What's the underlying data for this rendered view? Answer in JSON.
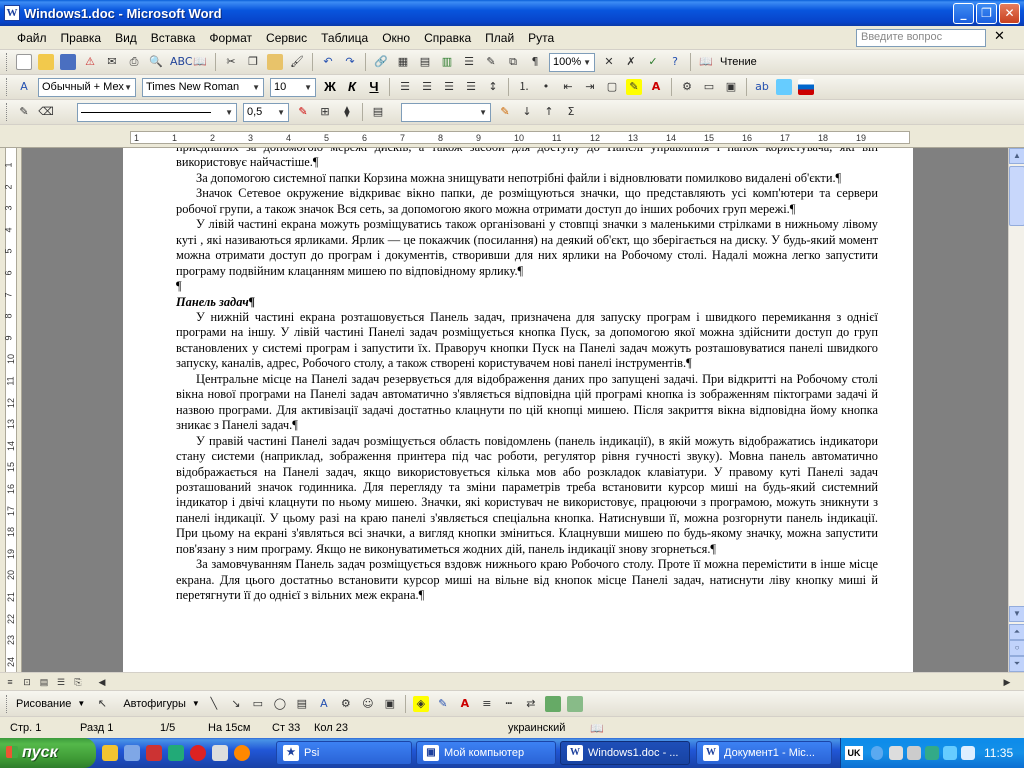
{
  "window": {
    "title": "Windows1.doc - Microsoft Word",
    "app_icon": "W",
    "minimize": "_",
    "maximize": "❐",
    "close": "✕"
  },
  "menubar": {
    "items": [
      "Файл",
      "Правка",
      "Вид",
      "Вставка",
      "Формат",
      "Сервис",
      "Таблица",
      "Окно",
      "Справка",
      "Плай",
      "Рута"
    ],
    "ask_placeholder": "Введите вопрос",
    "close_doc": "✕"
  },
  "toolbar_standard": {
    "zoom": "100%",
    "reading": "Чтение"
  },
  "toolbar_formatting": {
    "style": "Обычный + Мех",
    "font": "Times New Roman",
    "size": "10",
    "bold": "Ж",
    "italic": "К",
    "underline": "Ч"
  },
  "toolbar_tables": {
    "line_width": "0,5"
  },
  "ruler": {
    "h_numbers": [
      "1",
      "1",
      "2",
      "3",
      "4",
      "5",
      "6",
      "7",
      "8",
      "9",
      "10",
      "11",
      "12",
      "13",
      "14",
      "15",
      "16",
      "17",
      "18",
      "19"
    ],
    "v_numbers": [
      "1",
      "2",
      "3",
      "4",
      "5",
      "6",
      "7",
      "8",
      "9",
      "10",
      "11",
      "12",
      "13",
      "14",
      "15",
      "16",
      "17",
      "18",
      "19",
      "20",
      "21",
      "22",
      "23",
      "24"
    ]
  },
  "document": {
    "paragraphs": [
      {
        "cls": "",
        "text": "приєднаних за допомогою мережі дисків, а також засоби для доступу до Панелі управління і папок користувача, які він використовує найчастіше.¶"
      },
      {
        "cls": "ind",
        "text": "За допомогою системної папки Корзина можна знищувати непотрібні файли і відновлювати помилково видалені об'єкти.¶"
      },
      {
        "cls": "ind",
        "text": "Значок Сетевое окружение відкриває вікно папки, де розміщуються значки, що представляють усі комп'ютери та сервери робочої групи, а також значок Вся сеть, за допомогою якого можна отримати доступ до інших робочих груп мережі.¶"
      },
      {
        "cls": "ind",
        "text": "У лівій частині екрана можуть розміщуватись також організовані у стовпці значки з маленькими стрілками в нижньому лівому куті , які називаються ярликами. Ярлик — це покажчик (посилання) на деякий об'єкт, що зберігається на диску. У будь-який момент можна отримати доступ до програм і документів, створивши для них ярлики на Робочому столі. Надалі можна легко запустити програму подвійним клацанням мишею по відповідному ярлику.¶"
      },
      {
        "cls": "",
        "text": "¶"
      },
      {
        "cls": "heading",
        "text": "Панель задач¶"
      },
      {
        "cls": "ind",
        "text": "У нижній частині екрана розташовується Панель задач, призначена для запуску програм і швидкого перемикання з однієї програми на іншу. У лівій частині Панелі задач розміщується кнопка Пуск, за допомогою якої можна здійснити доступ до груп встановлених у системі програм і запустити їх. Праворуч кнопки Пуск на Панелі задач можуть розташовуватися панелі швидкого запуску, каналів, адрес, Робочого столу, а також створені користувачем нові панелі інструментів.¶"
      },
      {
        "cls": "ind",
        "text": "Центральне місце на Панелі задач резервується для відображення даних про запущені задачі. При відкритті на Робочому столі вікна нової програми на Панелі задач автоматично з'являється відповідна цій програмі кнопка із зображенням піктограми задачі й назвою програми. Для активізації задачі достатньо клацнути по цій кнопці мишею. Після закриття вікна відповідна йому кнопка зникає з Панелі задач.¶"
      },
      {
        "cls": "ind",
        "text": "У правій частині Панелі задач розміщується область повідомлень (панель індикації), в якій можуть відображатись індикатори стану системи (наприклад, зображення принтера під час роботи, регулятор рівня гучності звуку). Мовна панель автоматично відображається на Панелі задач, якщо використовується кілька мов або розкладок клавіатури. У правому куті Панелі задач розташований значок годинника. Для перегляду та зміни параметрів треба встановити курсор миші на будь-який системний індикатор і двічі клацнути по ньому мишею. Значки, які користувач не використовує, працюючи з програмою, можуть зникнути з панелі індикації. У цьому разі на краю панелі з'являється спеціальна кнопка. Натиснувши її, можна розгорнути панель індикації. При цьому на екрані з'являться всі значки, а вигляд кнопки зміниться. Клацнувши мишею по будь-якому значку, можна запустити пов'язану з ним програму. Якщо не виконуватиметься жодних дій, панель індикації знову згорнеться.¶"
      },
      {
        "cls": "ind",
        "text": "За замовчуванням Панель задач розміщується вздовж нижнього краю Робочого столу. Проте її можна перемістити в інше місце екрана. Для цього достатньо встановити курсор миші на вільне від кнопок місце Панелі задач, натиснути ліву кнопку миші й перетягнути її до однієї з вільних меж екрана.¶"
      }
    ]
  },
  "drawbar": {
    "draw": "Рисование",
    "autoshapes": "Автофигуры"
  },
  "statusbar": {
    "page": "Стр. 1",
    "section": "Разд 1",
    "pages": "1/5",
    "at": "На 15см",
    "line": "Ст 33",
    "col": "Кол 23",
    "language": "украинский"
  },
  "taskbar": {
    "start": "пуск",
    "buttons": [
      "Psi",
      "Мой компьютер",
      "Windows1.doc - ...",
      "Документ1 - Mic..."
    ],
    "lang": "UK",
    "time": "11:35"
  }
}
